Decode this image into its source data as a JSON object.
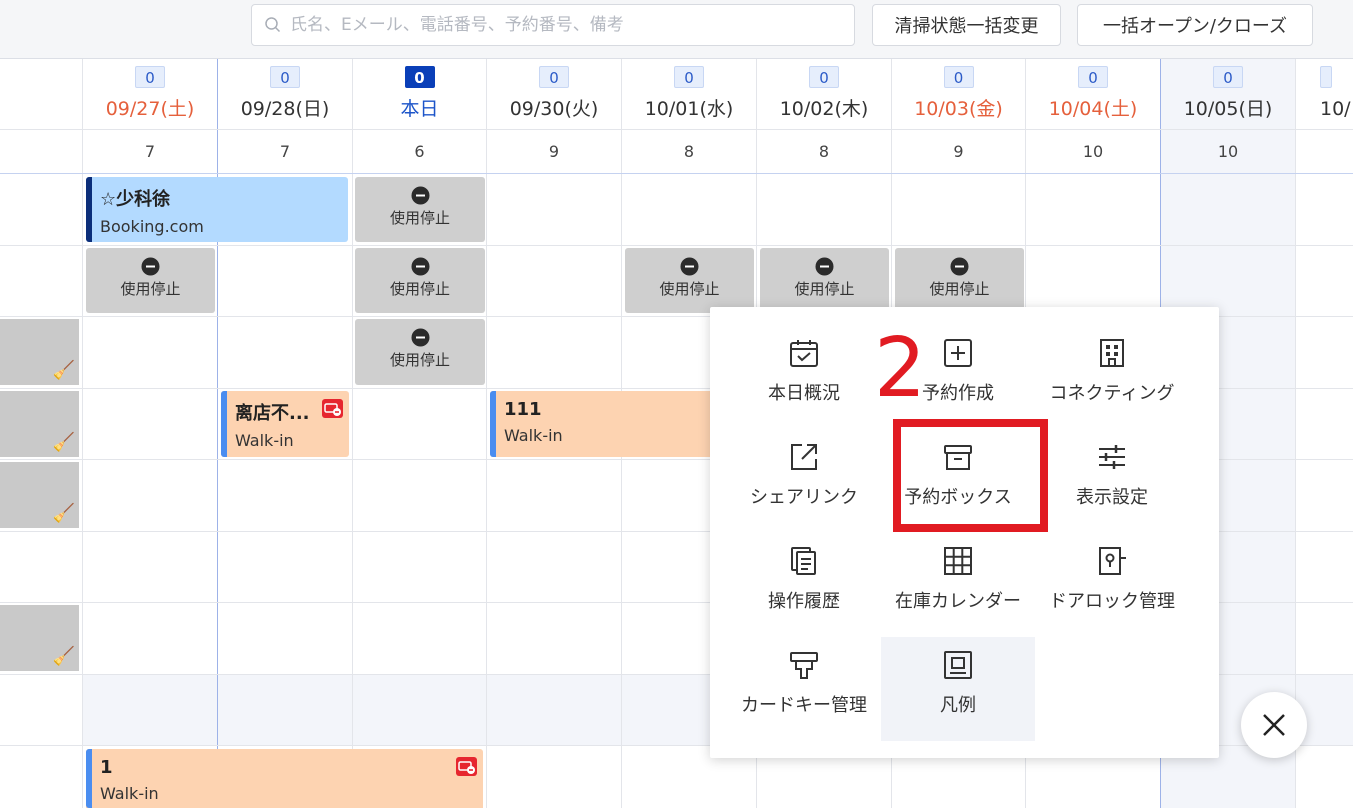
{
  "search": {
    "placeholder": "氏名、Eメール、電話番号、予約番号、備考"
  },
  "toolbar": {
    "bulk_clean_label": "清掃状態一括変更",
    "bulk_open_close_label": "一括オープン/クローズ"
  },
  "dates": [
    {
      "badge": "0",
      "label": "09/27(土)",
      "count": "7"
    },
    {
      "badge": "0",
      "label": "09/28(日)",
      "count": "7"
    },
    {
      "badge": "0",
      "label": "本日",
      "count": "6"
    },
    {
      "badge": "0",
      "label": "09/30(火)",
      "count": "9"
    },
    {
      "badge": "0",
      "label": "10/01(水)",
      "count": "8"
    },
    {
      "badge": "0",
      "label": "10/02(木)",
      "count": "8"
    },
    {
      "badge": "0",
      "label": "10/03(金)",
      "count": "9"
    },
    {
      "badge": "0",
      "label": "10/04(土)",
      "count": "10"
    },
    {
      "badge": "0",
      "label": "10/05(日)",
      "count": "10"
    },
    {
      "badge": "",
      "label": "10/",
      "count": ""
    }
  ],
  "stop_label": "使用停止",
  "reservations": {
    "r1": {
      "name": "☆少科徐",
      "source": "Booking.com"
    },
    "r2": {
      "name": "离店不...",
      "source": "Walk-in"
    },
    "r3": {
      "name": "111",
      "source": "Walk-in"
    },
    "r4": {
      "name": "1",
      "source": "Walk-in"
    }
  },
  "menu": {
    "items": [
      {
        "label": "本日概況",
        "icon": "calendar-check-icon"
      },
      {
        "label": "予約作成",
        "icon": "plus-square-icon"
      },
      {
        "label": "コネクティング",
        "icon": "building-icon"
      },
      {
        "label": "シェアリンク",
        "icon": "external-link-icon"
      },
      {
        "label": "予約ボックス",
        "icon": "archive-box-icon"
      },
      {
        "label": "表示設定",
        "icon": "sliders-icon"
      },
      {
        "label": "操作履歴",
        "icon": "history-copy-icon"
      },
      {
        "label": "在庫カレンダー",
        "icon": "grid-table-icon"
      },
      {
        "label": "ドアロック管理",
        "icon": "door-lock-icon"
      },
      {
        "label": "カードキー管理",
        "icon": "card-key-icon"
      },
      {
        "label": "凡例",
        "icon": "legend-icon"
      }
    ]
  },
  "annotation": {
    "step": "2"
  },
  "colors": {
    "accent": "#0a3fb8",
    "weekend": "#e5603c",
    "annotation": "#e11b22",
    "booking": "#b3daff",
    "walkin": "#fdd3b1"
  }
}
